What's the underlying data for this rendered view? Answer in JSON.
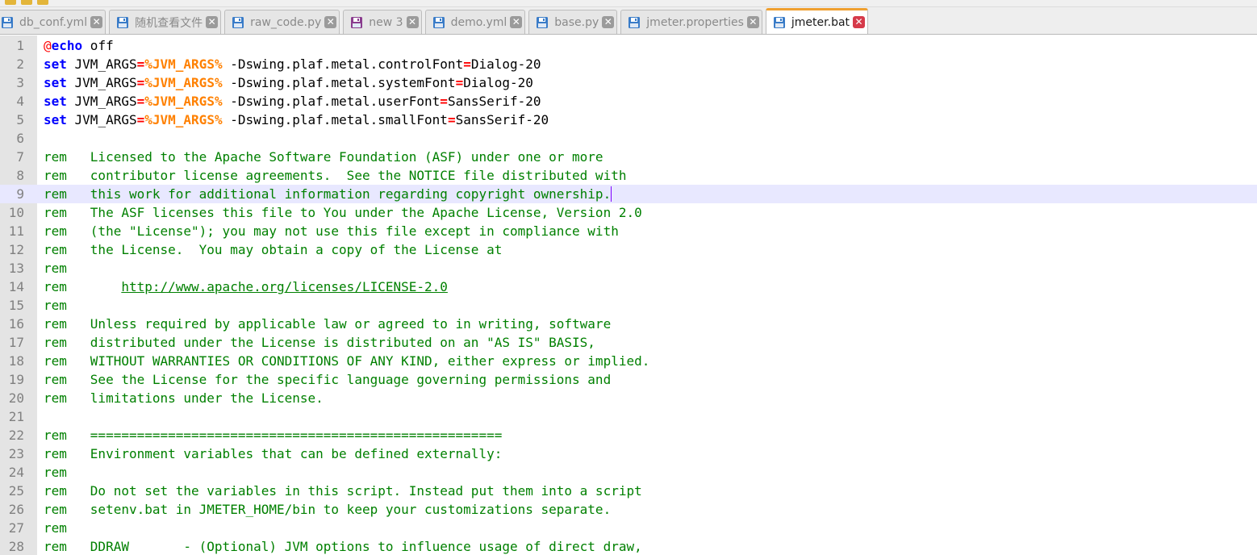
{
  "tabs": [
    {
      "label": "db_conf.yml",
      "icon": "save-icon",
      "active": false
    },
    {
      "label": "随机查看文件",
      "icon": "save-icon",
      "active": false
    },
    {
      "label": "raw_code.py",
      "icon": "save-icon",
      "active": false
    },
    {
      "label": "new 3",
      "icon": "unsaved-icon",
      "active": false
    },
    {
      "label": "demo.yml",
      "icon": "save-icon",
      "active": false
    },
    {
      "label": "base.py",
      "icon": "save-icon",
      "active": false
    },
    {
      "label": "jmeter.properties",
      "icon": "save-icon",
      "active": false
    },
    {
      "label": "jmeter.bat",
      "icon": "save-icon",
      "active": true
    }
  ],
  "close_glyph": "✕",
  "current_line": 9,
  "colors": {
    "keyword": "#0000ff",
    "operator": "#ff0000",
    "variable": "#ff8000",
    "comment": "#008000",
    "active_tab_accent": "#f0a030",
    "current_line_bg": "#e8e8ff"
  },
  "lines": [
    [
      [
        "at",
        "@"
      ],
      [
        "kw",
        "echo"
      ],
      [
        "t",
        " off"
      ]
    ],
    [
      [
        "kw",
        "set"
      ],
      [
        "t",
        " JVM_ARGS"
      ],
      [
        "eq",
        "="
      ],
      [
        "var",
        "%JVM_ARGS%"
      ],
      [
        "t",
        " -Dswing.plaf.metal.controlFont"
      ],
      [
        "eq",
        "="
      ],
      [
        "t",
        "Dialog-20"
      ]
    ],
    [
      [
        "kw",
        "set"
      ],
      [
        "t",
        " JVM_ARGS"
      ],
      [
        "eq",
        "="
      ],
      [
        "var",
        "%JVM_ARGS%"
      ],
      [
        "t",
        " -Dswing.plaf.metal.systemFont"
      ],
      [
        "eq",
        "="
      ],
      [
        "t",
        "Dialog-20"
      ]
    ],
    [
      [
        "kw",
        "set"
      ],
      [
        "t",
        " JVM_ARGS"
      ],
      [
        "eq",
        "="
      ],
      [
        "var",
        "%JVM_ARGS%"
      ],
      [
        "t",
        " -Dswing.plaf.metal.userFont"
      ],
      [
        "eq",
        "="
      ],
      [
        "t",
        "SansSerif-20"
      ]
    ],
    [
      [
        "kw",
        "set"
      ],
      [
        "t",
        " JVM_ARGS"
      ],
      [
        "eq",
        "="
      ],
      [
        "var",
        "%JVM_ARGS%"
      ],
      [
        "t",
        " -Dswing.plaf.metal.smallFont"
      ],
      [
        "eq",
        "="
      ],
      [
        "t",
        "SansSerif-20"
      ]
    ],
    [],
    [
      [
        "cm",
        "rem   Licensed to the Apache Software Foundation (ASF) under one or more"
      ]
    ],
    [
      [
        "cm",
        "rem   contributor license agreements.  See the NOTICE file distributed with"
      ]
    ],
    [
      [
        "cm",
        "rem   this work for additional information regarding copyright ownership."
      ],
      [
        "caret",
        ""
      ]
    ],
    [
      [
        "cm",
        "rem   The ASF licenses this file to You under the Apache License, Version 2.0"
      ]
    ],
    [
      [
        "cm",
        "rem   (the \"License\"); you may not use this file except in compliance with"
      ]
    ],
    [
      [
        "cm",
        "rem   the License.  You may obtain a copy of the License at"
      ]
    ],
    [
      [
        "cm",
        "rem"
      ]
    ],
    [
      [
        "cm",
        "rem       "
      ],
      [
        "link",
        "http://www.apache.org/licenses/LICENSE-2.0"
      ]
    ],
    [
      [
        "cm",
        "rem"
      ]
    ],
    [
      [
        "cm",
        "rem   Unless required by applicable law or agreed to in writing, software"
      ]
    ],
    [
      [
        "cm",
        "rem   distributed under the License is distributed on an \"AS IS\" BASIS,"
      ]
    ],
    [
      [
        "cm",
        "rem   WITHOUT WARRANTIES OR CONDITIONS OF ANY KIND, either express or implied."
      ]
    ],
    [
      [
        "cm",
        "rem   See the License for the specific language governing permissions and"
      ]
    ],
    [
      [
        "cm",
        "rem   limitations under the License."
      ]
    ],
    [],
    [
      [
        "cm",
        "rem   ====================================================="
      ]
    ],
    [
      [
        "cm",
        "rem   Environment variables that can be defined externally:"
      ]
    ],
    [
      [
        "cm",
        "rem"
      ]
    ],
    [
      [
        "cm",
        "rem   Do not set the variables in this script. Instead put them into a script"
      ]
    ],
    [
      [
        "cm",
        "rem   setenv.bat in JMETER_HOME/bin to keep your customizations separate."
      ]
    ],
    [
      [
        "cm",
        "rem"
      ]
    ],
    [
      [
        "cm",
        "rem   DDRAW       - (Optional) JVM options to influence usage of direct draw,"
      ]
    ]
  ]
}
